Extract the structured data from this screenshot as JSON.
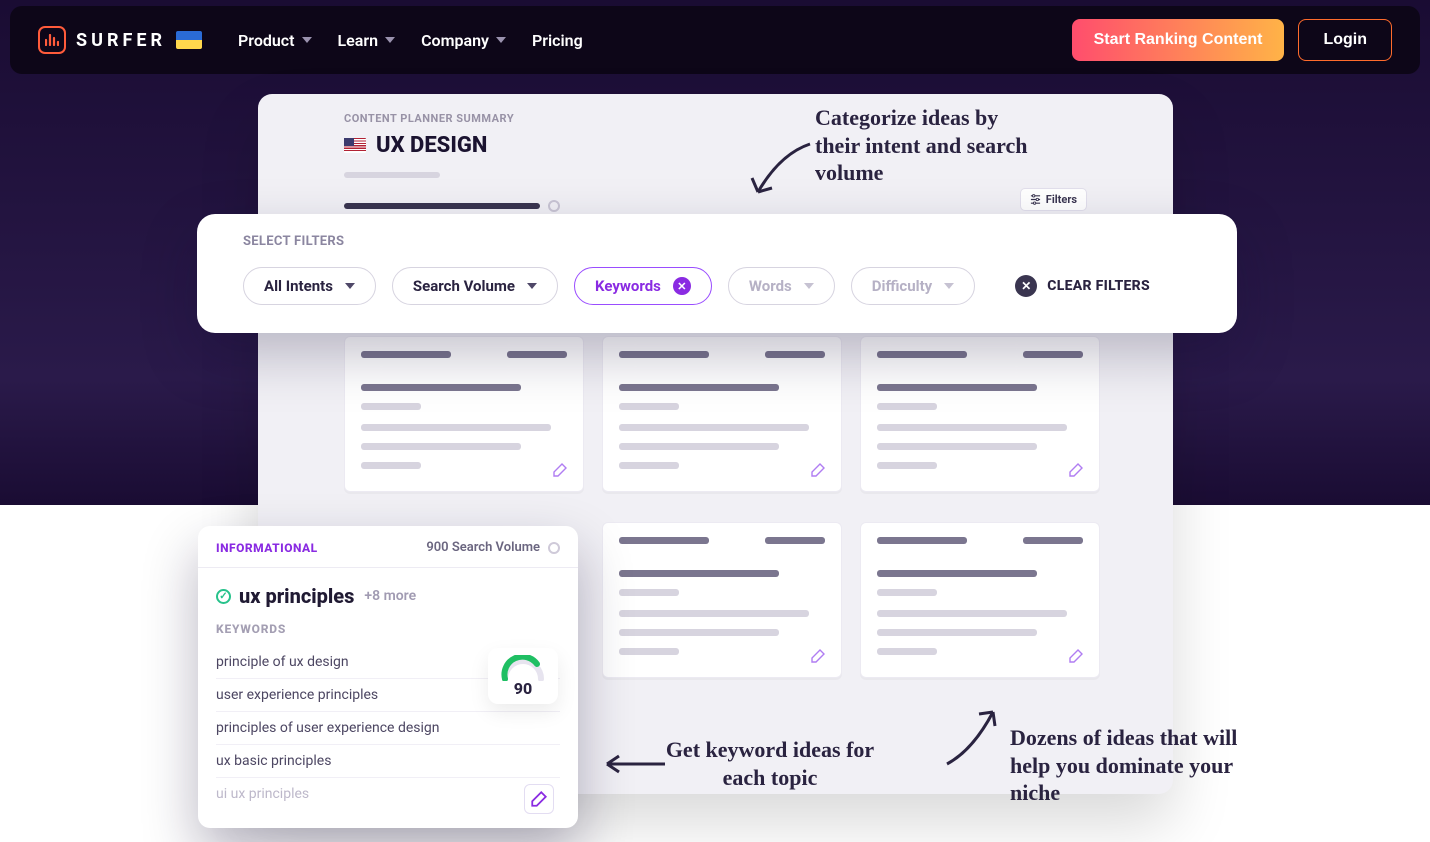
{
  "nav": {
    "brand": "SURFER",
    "items": [
      {
        "label": "Product",
        "hasMenu": true
      },
      {
        "label": "Learn",
        "hasMenu": true
      },
      {
        "label": "Company",
        "hasMenu": true
      },
      {
        "label": "Pricing",
        "hasMenu": false
      }
    ],
    "cta": "Start Ranking Content",
    "login": "Login"
  },
  "planner": {
    "subtitle": "CONTENT PLANNER SUMMARY",
    "title": "UX DESIGN",
    "filters_button": "Filters"
  },
  "filter_strip": {
    "label": "SELECT FILTERS",
    "chips": [
      {
        "label": "All Intents",
        "active": false,
        "muted": false,
        "removable": false
      },
      {
        "label": "Search Volume",
        "active": false,
        "muted": false,
        "removable": false
      },
      {
        "label": "Keywords",
        "active": true,
        "muted": false,
        "removable": true
      },
      {
        "label": "Words",
        "active": false,
        "muted": true,
        "removable": false
      },
      {
        "label": "Difficulty",
        "active": false,
        "muted": true,
        "removable": false
      }
    ],
    "clear": "CLEAR FILTERS"
  },
  "detail_card": {
    "intent": "INFORMATIONAL",
    "search_volume": "900 Search Volume",
    "topic": "ux principles",
    "more": "+8 more",
    "keywords_label": "KEYWORDS",
    "keywords": [
      "principle of ux design",
      "user experience principles",
      "principles of user experience design",
      "ux basic principles",
      "ui ux principles"
    ],
    "score": "90"
  },
  "annotations": {
    "a1": "Categorize ideas by their intent and search volume",
    "a2": "Get keyword ideas for each topic",
    "a3": "Dozens of ideas that will help you dominate your niche"
  }
}
